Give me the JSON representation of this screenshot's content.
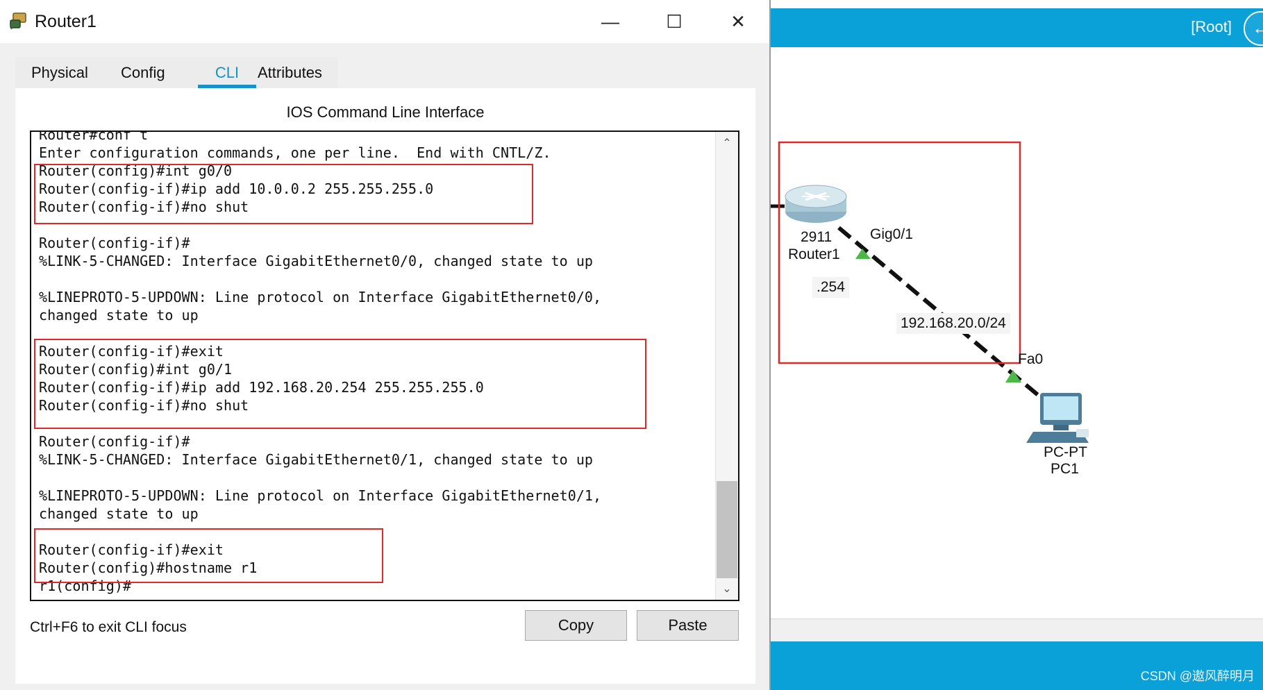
{
  "window": {
    "title": "Router1",
    "app_icon": "router-device-icon",
    "controls": {
      "minimize": "—",
      "maximize": "☐",
      "close": "✕"
    }
  },
  "tabs": [
    {
      "label": "Physical"
    },
    {
      "label": "Config"
    },
    {
      "label": "CLI",
      "active": true
    },
    {
      "label": "Attributes"
    }
  ],
  "cli": {
    "header": "IOS Command Line Interface",
    "lines": [
      "Router#conf t",
      "Enter configuration commands, one per line.  End with CNTL/Z.",
      "Router(config)#int g0/0",
      "Router(config-if)#ip add 10.0.0.2 255.255.255.0",
      "Router(config-if)#no shut",
      "",
      "Router(config-if)#",
      "%LINK-5-CHANGED: Interface GigabitEthernet0/0, changed state to up",
      "",
      "%LINEPROTO-5-UPDOWN: Line protocol on Interface GigabitEthernet0/0,",
      "changed state to up",
      "",
      "Router(config-if)#exit",
      "Router(config)#int g0/1",
      "Router(config-if)#ip add 192.168.20.254 255.255.255.0",
      "Router(config-if)#no shut",
      "",
      "Router(config-if)#",
      "%LINK-5-CHANGED: Interface GigabitEthernet0/1, changed state to up",
      "",
      "%LINEPROTO-5-UPDOWN: Line protocol on Interface GigabitEthernet0/1,",
      "changed state to up",
      "",
      "Router(config-if)#exit",
      "Router(config)#hostname r1",
      "r1(config)#"
    ],
    "focus_hint": "Ctrl+F6 to exit CLI focus",
    "copy_label": "Copy",
    "paste_label": "Paste",
    "highlight_color": "#e02828"
  },
  "workspace": {
    "root_label": "[Root]",
    "topbar_color": "#0aa0d8",
    "router": {
      "model": "2911",
      "name": "Router1",
      "ip_suffix": ".254",
      "port": "Gig0/1"
    },
    "link": {
      "network": "192.168.20.0/24",
      "style": "dashed"
    },
    "pc": {
      "model": "PC-PT",
      "name": "PC1",
      "port": "Fa0"
    },
    "port_status_color": "#4cb848",
    "highlight_color": "#e02828"
  },
  "watermark": "CSDN @遨风醉明月"
}
